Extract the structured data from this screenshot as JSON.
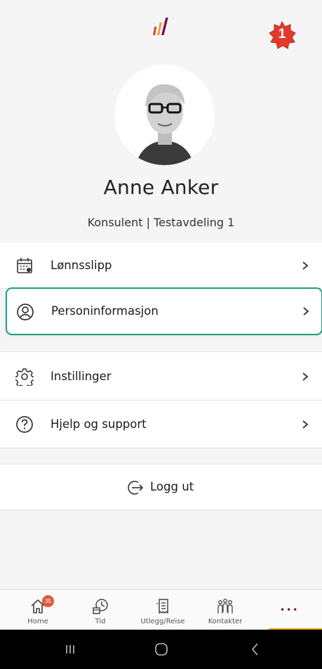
{
  "profile": {
    "name": "Anne Anker",
    "subtitle": "Konsulent | Testavdeling 1",
    "step_badge": "1"
  },
  "menu": {
    "items": [
      {
        "label": "Lønnsslipp",
        "icon": "payslip-calendar-icon"
      },
      {
        "label": "Personinformasjon",
        "icon": "person-icon"
      },
      {
        "label": "Instillinger",
        "icon": "gear-icon"
      },
      {
        "label": "Hjelp og support",
        "icon": "help-icon"
      }
    ]
  },
  "logout": {
    "label": "Logg ut",
    "icon": "logout-arrow-icon"
  },
  "tabbar": {
    "tabs": [
      {
        "label": "Home",
        "icon": "home-icon",
        "badge": "35"
      },
      {
        "label": "Tid",
        "icon": "time-icon"
      },
      {
        "label": "Utlegg/Reise",
        "icon": "receipt-icon"
      },
      {
        "label": "Kontakter",
        "icon": "contacts-icon"
      },
      {
        "label": "",
        "icon": "more-icon",
        "symbol": "•••"
      }
    ]
  },
  "colors": {
    "highlight": "#1e9e82",
    "badge": "#e0583a",
    "active_tab_underline": "#f0a230",
    "more_dots": "#7a0f4f"
  }
}
